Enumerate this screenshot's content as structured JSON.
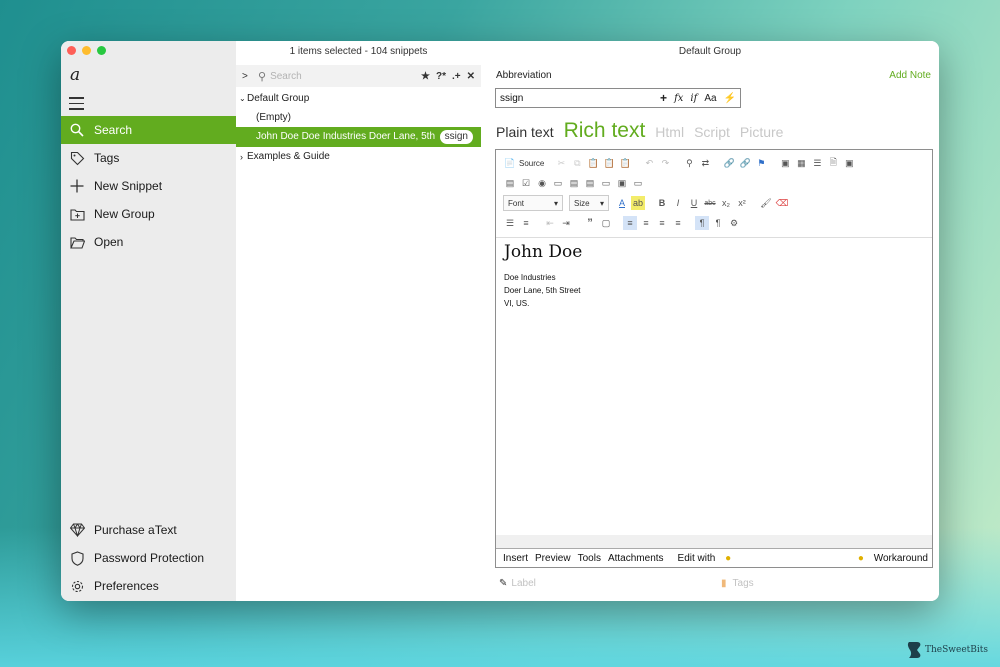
{
  "window": {
    "list_header": "1 items selected - 104 snippets",
    "editor_title": "Default Group"
  },
  "sidebar": {
    "logo": "a",
    "items": [
      {
        "label": "Search",
        "icon": "search-icon",
        "active": true
      },
      {
        "label": "Tags",
        "icon": "tag-icon"
      },
      {
        "label": "New Snippet",
        "icon": "plus-icon"
      },
      {
        "label": "New Group",
        "icon": "folder-plus-icon"
      },
      {
        "label": "Open",
        "icon": "folder-open-icon"
      }
    ],
    "bottom_items": [
      {
        "label": "Purchase aText",
        "icon": "diamond-icon"
      },
      {
        "label": "Password Protection",
        "icon": "shield-icon"
      },
      {
        "label": "Preferences",
        "icon": "gear-icon"
      }
    ]
  },
  "search": {
    "placeholder": "Search",
    "tools": [
      "★",
      "?*",
      ".+",
      "✕"
    ]
  },
  "tree": {
    "groups": [
      {
        "label": "Default Group",
        "expanded": true
      },
      {
        "label": "Examples & Guide",
        "expanded": false
      }
    ],
    "items": [
      {
        "label": "(Empty)"
      },
      {
        "label": "John Doe Doe Industries Doer Lane, 5th",
        "badge": "ssign",
        "selected": true
      }
    ]
  },
  "editor": {
    "abbreviation_label": "Abbreviation",
    "add_note": "Add Note",
    "abbreviation_value": "ssign",
    "abbr_tools": [
      "+",
      "fx",
      "if",
      "Aa",
      "⚡"
    ],
    "tabs": [
      "Plain text",
      "Rich text",
      "Html",
      "Script",
      "Picture"
    ],
    "active_tab": "Rich text",
    "toolbar": {
      "source": "Source",
      "font": "Font",
      "size": "Size"
    },
    "content": {
      "heading": "John Doe",
      "lines": [
        "Doe Industries",
        "Doer Lane, 5th Street",
        "VI, US."
      ]
    },
    "bottom_menu": [
      "Insert",
      "Preview",
      "Tools",
      "Attachments",
      "Edit with"
    ],
    "workaround": "Workaround",
    "label_placeholder": "Label",
    "tags_placeholder": "Tags"
  },
  "brand": "TheSweetBits",
  "colors": {
    "accent": "#62ac1f"
  }
}
